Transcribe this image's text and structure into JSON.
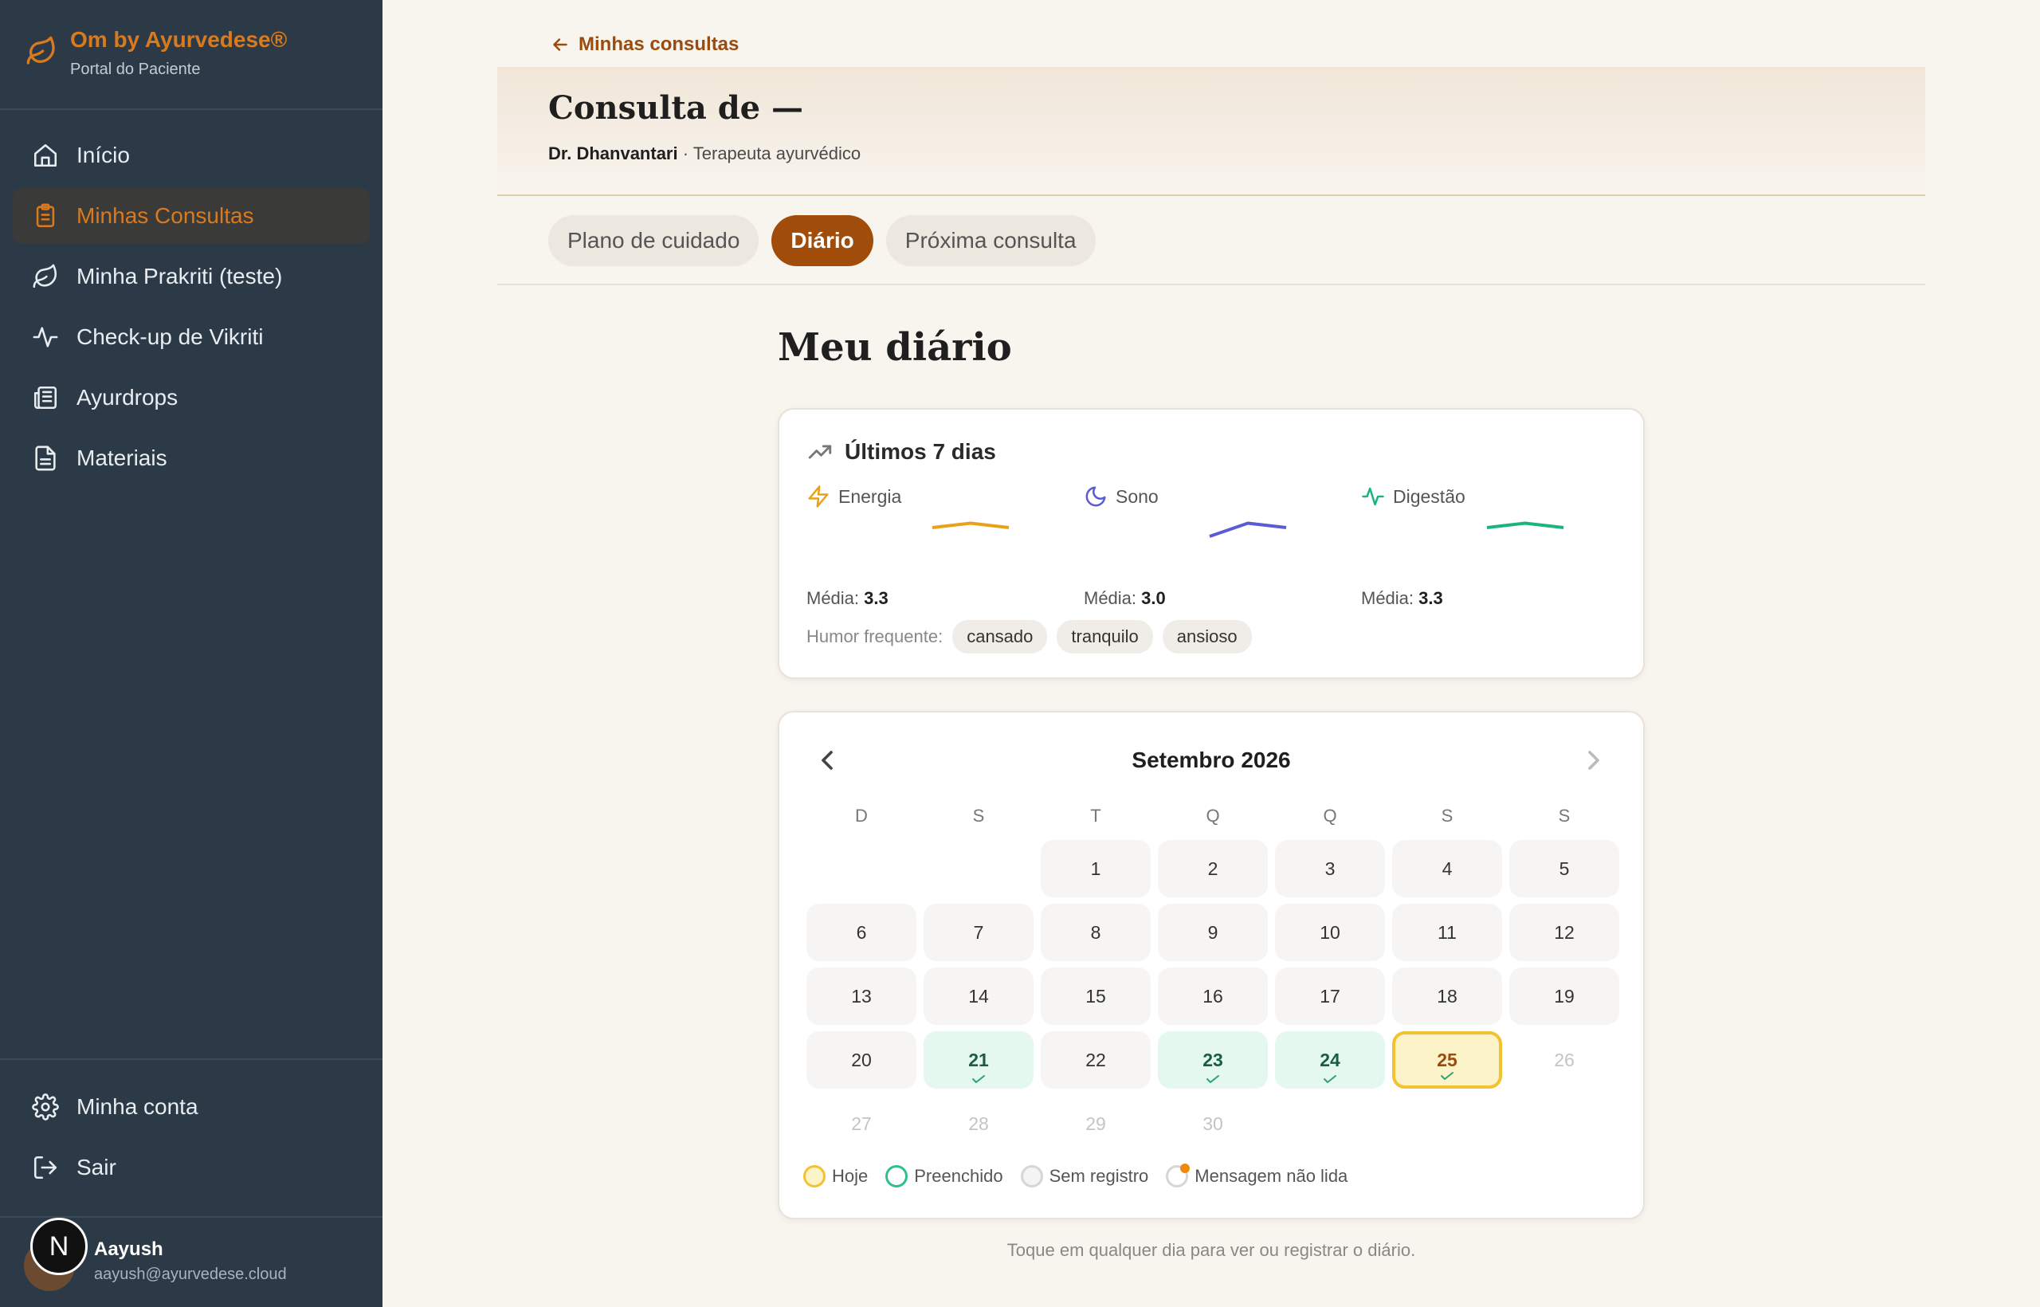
{
  "sidebar": {
    "brand_title": "Om by Ayurvedese®",
    "brand_sub": "Portal do Paciente",
    "items": [
      {
        "label": "Início",
        "icon": "home-icon"
      },
      {
        "label": "Minhas Consultas",
        "icon": "clipboard-icon",
        "active": true
      },
      {
        "label": "Minha Prakriti (teste)",
        "icon": "leaf-icon"
      },
      {
        "label": "Check-up de Vikriti",
        "icon": "activity-icon"
      },
      {
        "label": "Ayurdrops",
        "icon": "newspaper-icon"
      },
      {
        "label": "Materiais",
        "icon": "document-icon"
      }
    ],
    "bottom_items": [
      {
        "label": "Minha conta",
        "icon": "gear-icon"
      },
      {
        "label": "Sair",
        "icon": "logout-icon"
      }
    ],
    "user": {
      "initial": "N",
      "name": "Aayush",
      "email": "aayush@ayurvedese.cloud"
    }
  },
  "header": {
    "back_label": "Minhas consultas",
    "title": "Consulta de —",
    "doctor_name": "Dr. Dhanvantari",
    "doctor_role": " · Terapeuta ayurvédico"
  },
  "tabs": [
    {
      "label": "Plano de cuidado",
      "active": false
    },
    {
      "label": "Diário",
      "active": true
    },
    {
      "label": "Próxima consulta",
      "active": false
    }
  ],
  "diary": {
    "title": "Meu diário",
    "summary": {
      "heading": "Últimos 7 dias",
      "metrics": [
        {
          "label": "Energia",
          "avg_label": "Média:",
          "avg": "3.3",
          "color": "#e8a21a",
          "icon": "lightning-icon",
          "trend": [
            3,
            3.5,
            3
          ]
        },
        {
          "label": "Sono",
          "avg_label": "Média:",
          "avg": "3.0",
          "color": "#5b5bd6",
          "icon": "moon-icon",
          "trend": [
            2,
            3.5,
            3
          ]
        },
        {
          "label": "Digestão",
          "avg_label": "Média:",
          "avg": "3.3",
          "color": "#1bb57c",
          "icon": "activity-icon",
          "trend": [
            3,
            3.5,
            3
          ]
        }
      ],
      "mood_label": "Humor frequente:",
      "moods": [
        "cansado",
        "tranquilo",
        "ansioso"
      ]
    },
    "calendar": {
      "month": "Setembro 2026",
      "weekdays": [
        "D",
        "S",
        "T",
        "Q",
        "Q",
        "S",
        "S"
      ],
      "leading_blanks": 2,
      "days_in_month": 30,
      "filled_days": [
        21,
        23,
        24
      ],
      "today": 25,
      "future_from": 26
    },
    "legend": [
      "Hoje",
      "Preenchido",
      "Sem registro",
      "Mensagem não lida"
    ],
    "hint": "Toque em qualquer dia para ver ou registrar o diário."
  }
}
